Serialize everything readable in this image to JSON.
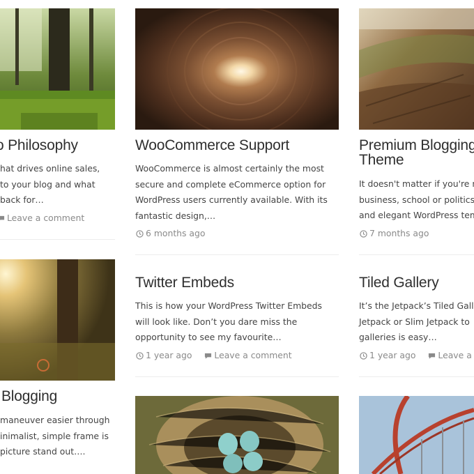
{
  "posts": [
    {
      "title": "o Philosophy",
      "excerpt": [
        "hat drives online sales,",
        "to your blog and what",
        "back for…"
      ],
      "comments": "Leave a comment"
    },
    {
      "title": "WooCommerce Support",
      "excerpt": [
        "WooCommerce is almost certainly the most",
        "secure and complete eCommerce option for",
        "WordPress users currently available. With its",
        "fantastic design,…"
      ],
      "date": "6 months ago"
    },
    {
      "title_lines": [
        "Premium Blogging",
        "Theme"
      ],
      "excerpt": [
        "It doesn't matter if you're m",
        "business, school or politics",
        "and elegant WordPress tem"
      ],
      "date": "7 months ago"
    },
    {
      "title": "Twitter Embeds",
      "excerpt": [
        "This is how your WordPress Twitter Embeds",
        "will look like. Don’t you dare miss the",
        "opportunity to see my favourite…"
      ],
      "date": "1 year ago",
      "comments": "Leave a comment"
    },
    {
      "title": "Tiled Gallery",
      "excerpt": [
        "It’s the Jetpack’s Tiled Galle",
        "Jetpack or Slim Jetpack to",
        "galleries is easy…"
      ],
      "date": "1 year ago",
      "comments": "Leave a c"
    },
    {
      "title": "Blogging",
      "excerpt": [
        "maneuver easier through",
        "inimalist, simple frame is",
        "picture stand out…."
      ]
    }
  ],
  "colors": {
    "title": "#2f2f2f",
    "text": "#444444",
    "meta": "#8a8a8a",
    "separator": "#ececec"
  },
  "icons": [
    "clock-icon",
    "comment-icon"
  ]
}
